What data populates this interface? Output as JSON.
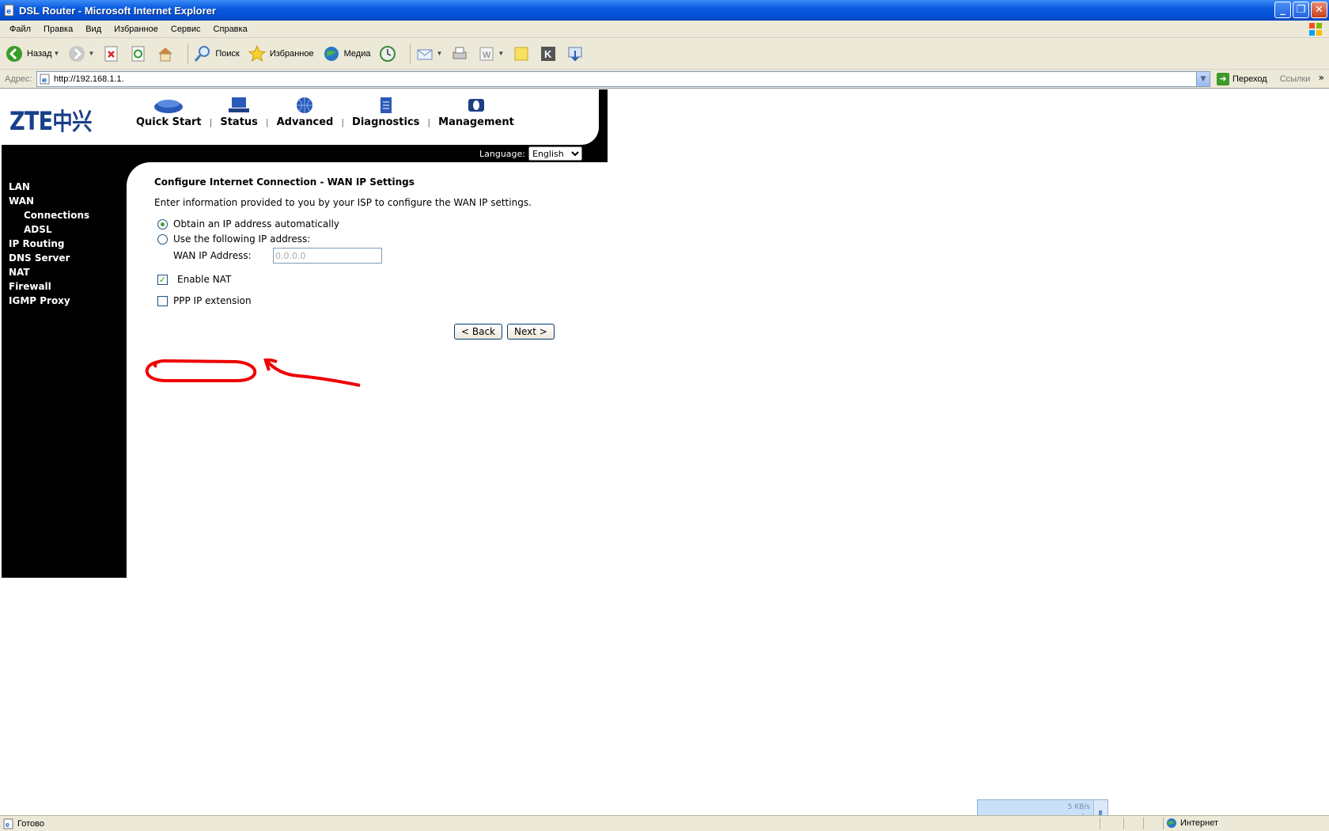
{
  "window": {
    "title": "DSL Router - Microsoft Internet Explorer"
  },
  "menu": [
    "Файл",
    "Правка",
    "Вид",
    "Избранное",
    "Сервис",
    "Справка"
  ],
  "toolbar": {
    "back": "Назад",
    "search": "Поиск",
    "favorites": "Избранное",
    "media": "Медиа"
  },
  "address": {
    "label": "Адрес:",
    "url": "http://192.168.1.1.",
    "go": "Переход",
    "links": "Ссылки"
  },
  "router": {
    "logo": "ZTE",
    "logo_cn": "中兴",
    "nav": [
      "Quick Start",
      "Status",
      "Advanced",
      "Diagnostics",
      "Management"
    ],
    "language_label": "Language:",
    "language_value": "English",
    "sidebar": [
      "LAN",
      "WAN",
      "Connections",
      "ADSL",
      "IP Routing",
      "DNS Server",
      "NAT",
      "Firewall",
      "IGMP Proxy"
    ],
    "heading": "Configure Internet Connection - WAN IP Settings",
    "description": "Enter information provided to you by your ISP to configure the WAN IP settings.",
    "option_auto": "Obtain an IP address automatically",
    "option_manual": "Use the following IP address:",
    "wan_ip_label": "WAN IP Address:",
    "wan_ip_value": "0.0.0.0",
    "enable_nat": "Enable NAT",
    "ppp_ext": "PPP IP extension",
    "back_btn": "< Back",
    "next_btn": "Next >"
  },
  "widget": {
    "speed": "5 KB/s"
  },
  "status": {
    "ready": "Готово",
    "zone": "Интернет"
  }
}
